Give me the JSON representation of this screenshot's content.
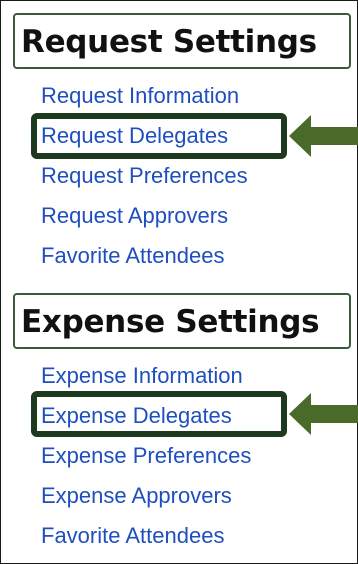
{
  "request_settings": {
    "title": "Request Settings",
    "links": [
      "Request Information",
      "Request Delegates",
      "Request Preferences",
      "Request Approvers",
      "Favorite Attendees"
    ]
  },
  "expense_settings": {
    "title": "Expense Settings",
    "links": [
      "Expense Information",
      "Expense Delegates",
      "Expense Preferences",
      "Expense Approvers",
      "Favorite Attendees"
    ]
  },
  "colors": {
    "link": "#1f4fbf",
    "highlight_border": "#1e3a1e",
    "arrow": "#4a6a2a",
    "header_border": "#3a5a3a"
  },
  "icons": [
    "arrow-left-icon"
  ]
}
